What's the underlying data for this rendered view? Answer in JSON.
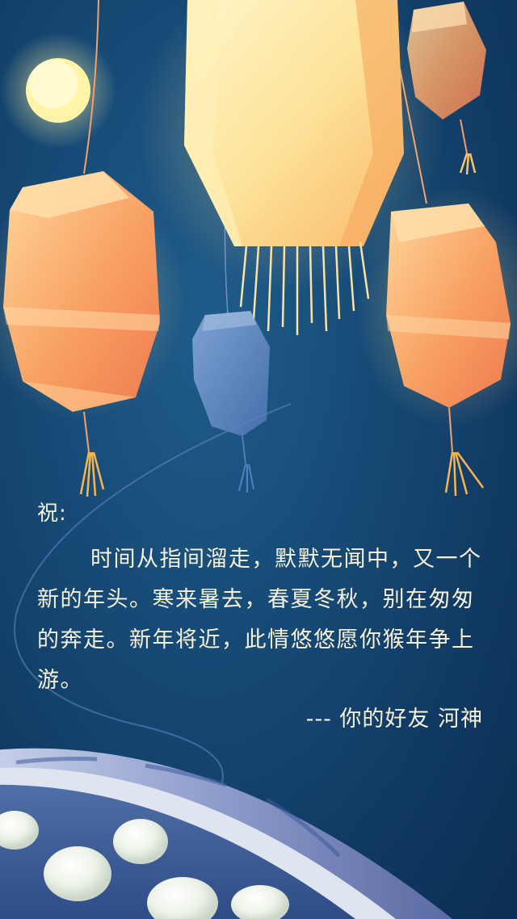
{
  "card": {
    "greeting": "祝:",
    "body": "时间从指间溜走，默默无闻中，又一个新的年头。寒来暑去，春夏冬秋，别在匆匆的奔走。新年将近，此情悠悠愿你猴年争上游。",
    "signature": "--- 你的好友 河神"
  },
  "colors": {
    "background": "#123f6a",
    "text": "#f6f1d8",
    "lantern_orange": "#f59a5e",
    "lantern_yellow": "#fde9a6",
    "lantern_blue": "#5b86c4",
    "moon": "#fff4a8"
  }
}
